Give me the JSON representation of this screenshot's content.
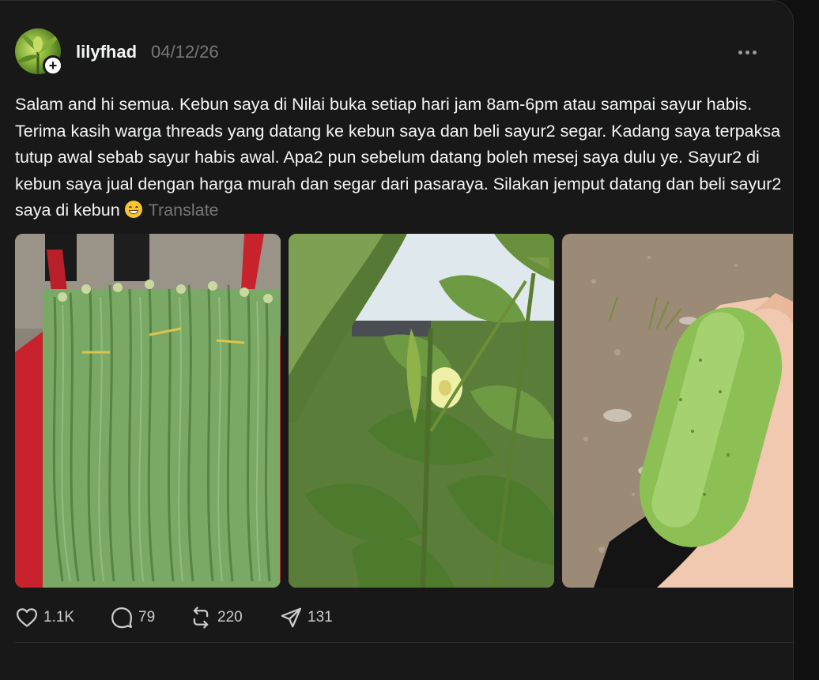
{
  "post": {
    "username": "lilyfhad",
    "date": "04/12/26",
    "text": "Salam and hi semua. Kebun saya di Nilai buka setiap hari jam 8am-6pm atau sampai sayur habis. Terima kasih warga threads yang datang ke kebun saya dan beli sayur2 segar. Kadang saya terpaksa tutup awal sebab sayur habis awal. Apa2 pun sebelum datang boleh mesej saya dulu ye. Sayur2 di kebun saya jual dengan harga murah dan segar dari pasaraya. Silakan jemput datang dan beli sayur2 saya di kebun",
    "emoji": "grinning-face-emoji",
    "translate_label": "Translate",
    "follow_badge": "+"
  },
  "photos": [
    {
      "subject": "long-beans-in-red-wheelbarrow"
    },
    {
      "subject": "okra-plant"
    },
    {
      "subject": "cucumber-in-hand"
    }
  ],
  "actions": {
    "likes": "1.1K",
    "replies": "79",
    "reposts": "220",
    "shares": "131"
  },
  "icons": {
    "like": "heart-icon",
    "reply": "comment-bubble-icon",
    "repost": "repost-icon",
    "share": "send-icon",
    "more": "more-horizontal-icon"
  },
  "colors": {
    "background": "#101010",
    "card": "#181818",
    "text": "#f3f5f7",
    "muted": "#777777"
  }
}
